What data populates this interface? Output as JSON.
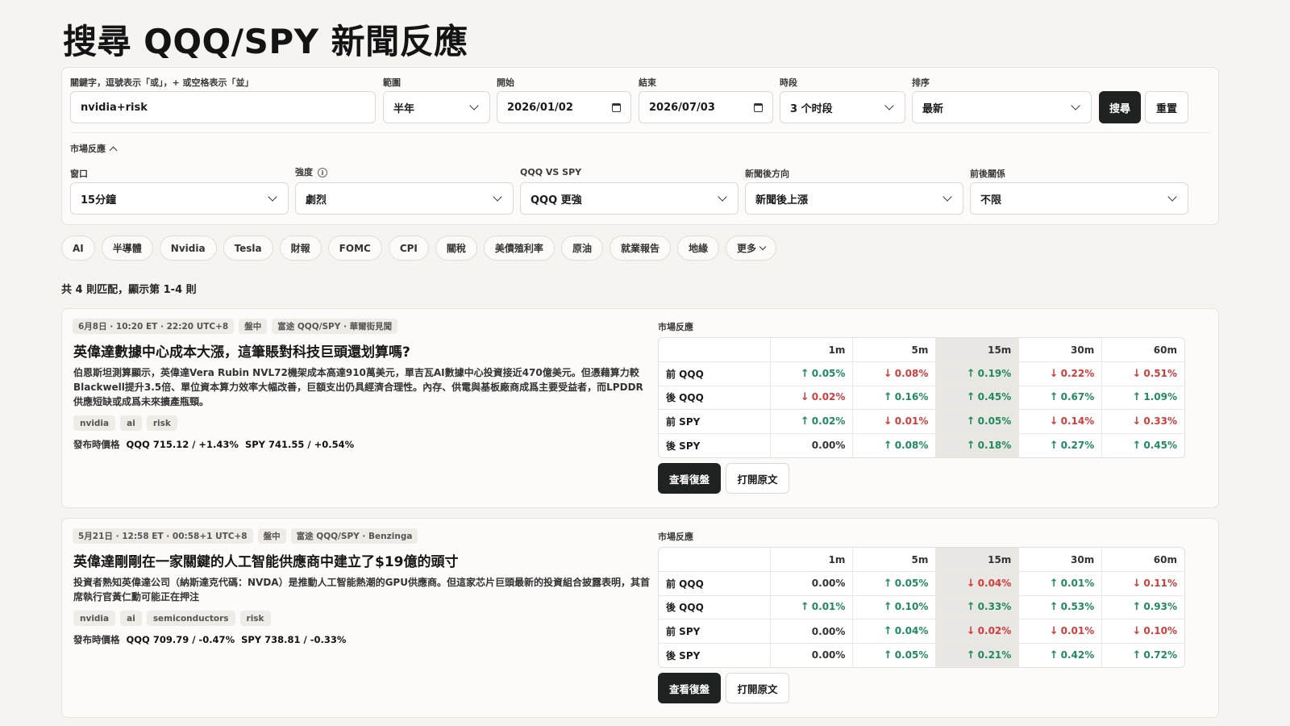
{
  "title": "搜尋 QQQ/SPY 新聞反應",
  "search": {
    "keyword_label": "關鍵字，逗號表示「或」，+ 或空格表示「並」",
    "keyword_value": "nvidia+risk",
    "range_label": "範圍",
    "range_value": "半年",
    "start_label": "開始",
    "start_value": "2026/01/02",
    "end_label": "結束",
    "end_value": "2026/07/03",
    "session_label": "時段",
    "session_value": "3 个时段",
    "sort_label": "排序",
    "sort_value": "最新",
    "search_button": "搜尋",
    "reset_button": "重置"
  },
  "market_filters": {
    "toggle_label": "市場反應",
    "window_label": "窗口",
    "window_value": "15分鐘",
    "intensity_label": "強度",
    "intensity_value": "劇烈",
    "qqq_vs_spy_label": "QQQ VS SPY",
    "qqq_vs_spy_value": "QQQ 更強",
    "direction_label": "新聞後方向",
    "direction_value": "新聞後上漲",
    "relation_label": "前後關係",
    "relation_value": "不限"
  },
  "chips": [
    "AI",
    "半導體",
    "Nvidia",
    "Tesla",
    "財報",
    "FOMC",
    "CPI",
    "關稅",
    "美債殖利率",
    "原油",
    "就業報告",
    "地緣"
  ],
  "chips_more": "更多",
  "summary": "共 4 則匹配，顯示第 1-4 則",
  "columns": [
    "",
    "1m",
    "5m",
    "15m",
    "30m",
    "60m"
  ],
  "news": [
    {
      "time": "6月8日 · 10:20 ET · 22:20 UTC+8",
      "session": "盤中",
      "source": "富途 QQQ/SPY · 華爾街見聞",
      "headline": "英偉達數據中心成本大漲，這筆賬對科技巨頭還划算嗎?",
      "desc": "伯恩斯坦測算顯示，英偉達Vera Rubin NVL72機架成本高達910萬美元，單吉瓦AI數據中心投資接近470億美元。但憑藉算力較Blackwell提升3.5倍、單位資本算力效率大幅改善，巨額支出仍具經濟合理性。內存、供電與基板廠商成爲主要受益者，而LPDDR供應短缺或成爲未來擴產瓶頸。",
      "tags": [
        "nvidia",
        "ai",
        "risk"
      ],
      "price_label": "發布時價格",
      "qqq_price": "QQQ 715.12 / +1.43%",
      "spy_price": "SPY 741.55 / +0.54%",
      "reaction_label": "市場反應",
      "rows": [
        {
          "label": "前 QQQ",
          "cells": [
            {
              "v": "0.05%",
              "d": "up"
            },
            {
              "v": "0.08%",
              "d": "dn"
            },
            {
              "v": "0.19%",
              "d": "up"
            },
            {
              "v": "0.22%",
              "d": "dn"
            },
            {
              "v": "0.51%",
              "d": "dn"
            }
          ]
        },
        {
          "label": "後 QQQ",
          "cells": [
            {
              "v": "0.02%",
              "d": "dn"
            },
            {
              "v": "0.16%",
              "d": "up"
            },
            {
              "v": "0.45%",
              "d": "up"
            },
            {
              "v": "0.67%",
              "d": "up"
            },
            {
              "v": "1.09%",
              "d": "up"
            }
          ]
        },
        {
          "label": "前 SPY",
          "cells": [
            {
              "v": "0.02%",
              "d": "up"
            },
            {
              "v": "0.01%",
              "d": "dn"
            },
            {
              "v": "0.05%",
              "d": "up"
            },
            {
              "v": "0.14%",
              "d": "dn"
            },
            {
              "v": "0.33%",
              "d": "dn"
            }
          ]
        },
        {
          "label": "後 SPY",
          "cells": [
            {
              "v": "0.00%",
              "d": "flat"
            },
            {
              "v": "0.08%",
              "d": "up"
            },
            {
              "v": "0.18%",
              "d": "up"
            },
            {
              "v": "0.27%",
              "d": "up"
            },
            {
              "v": "0.45%",
              "d": "up"
            }
          ]
        }
      ],
      "review_button": "查看復盤",
      "open_button": "打開原文"
    },
    {
      "time": "5月21日 · 12:58 ET · 00:58+1 UTC+8",
      "session": "盤中",
      "source": "富途 QQQ/SPY · Benzinga",
      "headline": "英偉達剛剛在一家關鍵的人工智能供應商中建立了$19億的頭寸",
      "desc": "投資者熟知英偉達公司（納斯達克代碼：NVDA）是推動人工智能熱潮的GPU供應商。但這家芯片巨頭最新的投資組合披露表明，其首席執行官黃仁勳可能正在押注",
      "tags": [
        "nvidia",
        "ai",
        "semiconductors",
        "risk"
      ],
      "price_label": "發布時價格",
      "qqq_price": "QQQ 709.79 / -0.47%",
      "spy_price": "SPY 738.81 / -0.33%",
      "reaction_label": "市場反應",
      "rows": [
        {
          "label": "前 QQQ",
          "cells": [
            {
              "v": "0.00%",
              "d": "flat"
            },
            {
              "v": "0.05%",
              "d": "up"
            },
            {
              "v": "0.04%",
              "d": "dn"
            },
            {
              "v": "0.01%",
              "d": "up"
            },
            {
              "v": "0.11%",
              "d": "dn"
            }
          ]
        },
        {
          "label": "後 QQQ",
          "cells": [
            {
              "v": "0.01%",
              "d": "up"
            },
            {
              "v": "0.10%",
              "d": "up"
            },
            {
              "v": "0.33%",
              "d": "up"
            },
            {
              "v": "0.53%",
              "d": "up"
            },
            {
              "v": "0.93%",
              "d": "up"
            }
          ]
        },
        {
          "label": "前 SPY",
          "cells": [
            {
              "v": "0.00%",
              "d": "flat"
            },
            {
              "v": "0.04%",
              "d": "up"
            },
            {
              "v": "0.02%",
              "d": "dn"
            },
            {
              "v": "0.01%",
              "d": "dn"
            },
            {
              "v": "0.10%",
              "d": "dn"
            }
          ]
        },
        {
          "label": "後 SPY",
          "cells": [
            {
              "v": "0.00%",
              "d": "flat"
            },
            {
              "v": "0.05%",
              "d": "up"
            },
            {
              "v": "0.21%",
              "d": "up"
            },
            {
              "v": "0.42%",
              "d": "up"
            },
            {
              "v": "0.72%",
              "d": "up"
            }
          ]
        }
      ],
      "review_button": "查看復盤",
      "open_button": "打開原文"
    }
  ],
  "colors": {
    "up": "#1f8a5e",
    "down": "#d43b3b",
    "button_dark": "#1e2220",
    "background": "#f6f4f1"
  }
}
